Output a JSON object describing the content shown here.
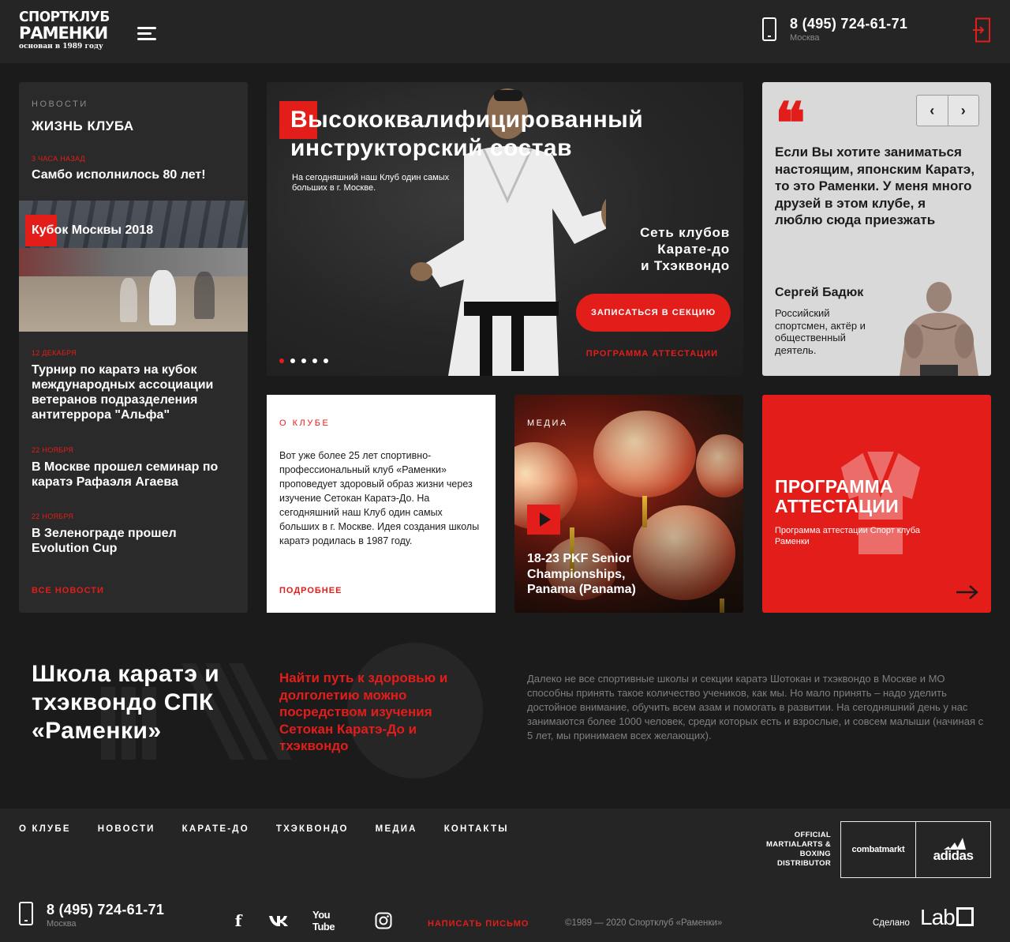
{
  "colors": {
    "accent": "#e31d1a",
    "background": "#1b1b1b",
    "panel": "#2a2a2a",
    "light_card": "#d9d9d9"
  },
  "header": {
    "logo": {
      "line1": "СПОРТКЛУБ",
      "line2": "РАМЕНКИ",
      "line3": "основан в 1989 году"
    },
    "menu_icon": "hamburger-icon",
    "phone": "8 (495) 724-61-71",
    "city": "Москва",
    "login_icon": "login-icon"
  },
  "news": {
    "eyebrow": "НОВОСТИ",
    "title": "ЖИЗНЬ КЛУБА",
    "items": [
      {
        "date": "3 ЧАСА НАЗАД",
        "headline": "Самбо исполнилось 80 лет!"
      },
      {
        "date": "12 ДЕКАБРЯ",
        "headline": "Турнир по каратэ на кубок международных ассоциации ветеранов подразделения антитеррора \"Альфа\""
      },
      {
        "date": "22 НОЯБРЯ",
        "headline": "В Москве прошел семинар по каратэ Рафаэля Агаева"
      },
      {
        "date": "22 НОЯБРЯ",
        "headline": "В Зеленограде прошел Evolution Cup"
      }
    ],
    "photo_tag": "Кубок Москвы 2018",
    "all_link": "ВСЕ НОВОСТИ"
  },
  "hero": {
    "title": "Высококвалифицированный инструкторский состав",
    "subtitle": "На сегодняшний наш Клуб один самых больших в г. Москве.",
    "network": "Сеть клубов\nКарате-до\nи Тхэквондо",
    "cta": "ЗАПИСАТЬСЯ В СЕКЦИЮ",
    "program_link": "ПРОГРАММА АТТЕСТАЦИИ",
    "slides_total": 5,
    "slide_active": 1
  },
  "testimonial": {
    "quote": "Если Вы хотите заниматься настоящим, японским Каратэ, то это Раменки. У меня много друзей в этом клубе, я люблю сюда приезжать",
    "name": "Сергей Бадюк",
    "role": "Российский спортсмен, актёр и общественный деятель.",
    "prev_icon": "chevron-left-icon",
    "next_icon": "chevron-right-icon"
  },
  "about": {
    "eyebrow": "О КЛУБЕ",
    "text": "Вот уже более 25 лет спортивно-профессиональный клуб «Раменки» проповедует здоровый образ жизни через изучение Сетокан Каратэ-До. На сегодняшний наш Клуб один самых больших в г. Москве. Идея создания школы каратэ родилась в 1987 году.",
    "more_link": "ПОДРОБНЕЕ"
  },
  "media": {
    "eyebrow": "МЕДИА",
    "caption": "18-23 PKF Senior Championships, Panama (Panama)",
    "play_icon": "play-icon"
  },
  "attestation": {
    "title": "ПРОГРАММА АТТЕСТАЦИИ",
    "subtitle": "Программа аттестации Спорт клуба Раменки",
    "arrow_icon": "arrow-right-icon"
  },
  "school": {
    "heading": "Школа каратэ и тхэквондо СПК «Раменки»",
    "slogan": "Найти путь к здоровью и долголетию можно посредством изучения Сетокан Каратэ-До и тхэквондо",
    "description": "Далеко не все спортивные школы и секции каратэ Шотокан и тхэквондо в Москве и МО способны принять такое количество учеников, как мы. Но мало принять – надо уделить достойное внимание, обучить всем азам и помогать в развитии. На сегодняшний день у нас занимаются более 1000 человек, среди которых есть и взрослые, и совсем малыши (начиная с 5 лет, мы принимаем всех желающих)."
  },
  "footer": {
    "nav": [
      "О КЛУБЕ",
      "НОВОСТИ",
      "КАРАТЕ-ДО",
      "ТХЭКВОНДО",
      "МЕДИА",
      "КОНТАКТЫ"
    ],
    "distributor": "OFFICIAL MARTIALARTS & BOXING DISTRIBUTOR",
    "brand1": "combatmarkt",
    "brand2": "adidas",
    "phone": "8 (495) 724-61-71",
    "city": "Москва",
    "social": {
      "facebook": "f",
      "youtube": "You Tube",
      "youtube_icon": "youtube-icon",
      "vk_icon": "vk-icon",
      "instagram_icon": "instagram-icon"
    },
    "write_link": "НАПИСАТЬ ПИСЬМО",
    "copyright": "©1989 — 2020 Спортклуб «Раменки»",
    "made_by": "Сделано",
    "studio": "Lab"
  }
}
